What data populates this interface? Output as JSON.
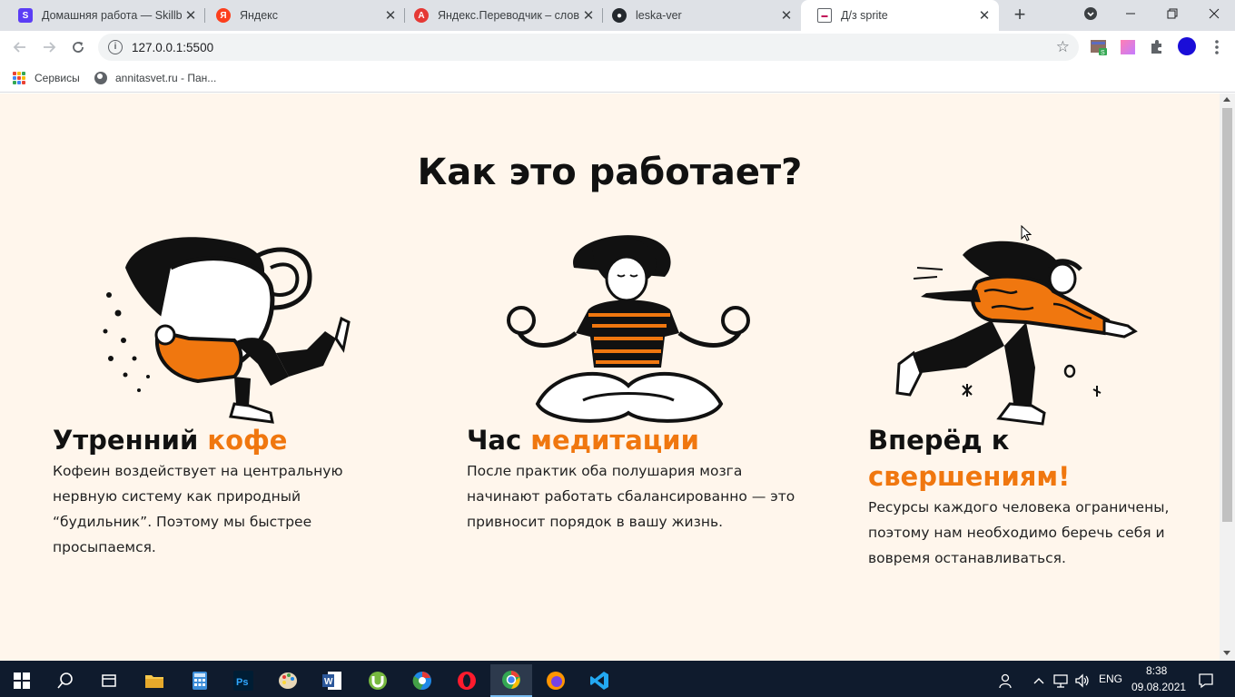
{
  "browser": {
    "tabs": [
      {
        "title": "Домашняя работа — Skillbox",
        "favicon": "skillbox-icon",
        "active": false
      },
      {
        "title": "Яндекс",
        "favicon": "yandex-icon",
        "active": false
      },
      {
        "title": "Яндекс.Переводчик – слова",
        "favicon": "translator-icon",
        "active": false
      },
      {
        "title": "leska-ver",
        "favicon": "github-icon",
        "active": false
      },
      {
        "title": "Д/з sprite",
        "favicon": "page-icon",
        "active": true
      }
    ],
    "address": "127.0.0.1:5500",
    "bookmarks": [
      {
        "label": "Сервисы",
        "icon": "apps-icon"
      },
      {
        "label": "annitasvet.ru - Пан...",
        "icon": "globe-icon"
      }
    ]
  },
  "page": {
    "title": "Как это работает?",
    "cards": [
      {
        "title_plain": "Утренний ",
        "title_accent": "кофе",
        "text": "Кофеин воздействует на центральную нервную систему как природный “будильник”. Поэтому мы быстрее просыпаемся.",
        "illustration": "coffee-illustration"
      },
      {
        "title_plain": "Час ",
        "title_accent": "медитации",
        "text": "После практик оба полушария мозга начинают работать сбалансированно — это привносит порядок в вашу жизнь.",
        "illustration": "meditation-illustration"
      },
      {
        "title_plain": "Вперёд к ",
        "title_accent": "свершениям!",
        "text": "Ресурсы каждого человека ограничены, поэтому нам необходимо беречь себя и вовремя останавливаться.",
        "illustration": "running-illustration"
      }
    ]
  },
  "taskbar": {
    "language": "ENG",
    "time": "8:38",
    "date": "09.08.2021"
  },
  "colors": {
    "accent": "#f0770f",
    "page_background": "#fff6ec"
  }
}
